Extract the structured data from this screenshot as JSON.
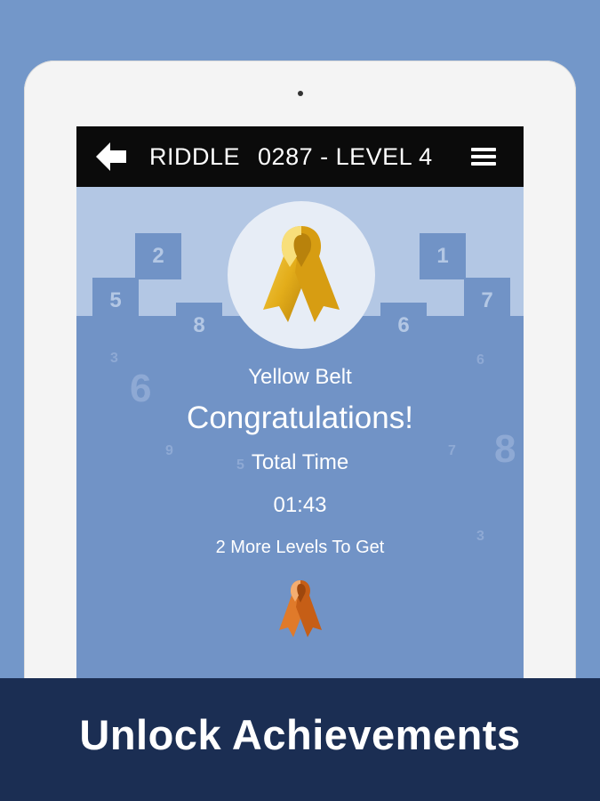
{
  "header": {
    "title_left": "RIDDLE",
    "title_right": "0287 -  LEVEL 4"
  },
  "decor_numbers": {
    "tile_left_top": "2",
    "tile_left_mid": "5",
    "tile_left_low": "8",
    "tile_right_top": "1",
    "tile_right_mid": "7",
    "tile_right_low": "6",
    "scatter": [
      "3",
      "6",
      "9",
      "5",
      "6",
      "7",
      "8",
      "3"
    ]
  },
  "achievement": {
    "belt_name": "Yellow Belt",
    "congrats": "Congratulations!",
    "time_label": "Total Time",
    "time_value": "01:43",
    "remaining": "2 More Levels To Get",
    "current_ribbon_color": "#e3ad1a",
    "next_ribbon_color": "#e07a2a"
  },
  "banner": {
    "text": "Unlock Achievements"
  }
}
